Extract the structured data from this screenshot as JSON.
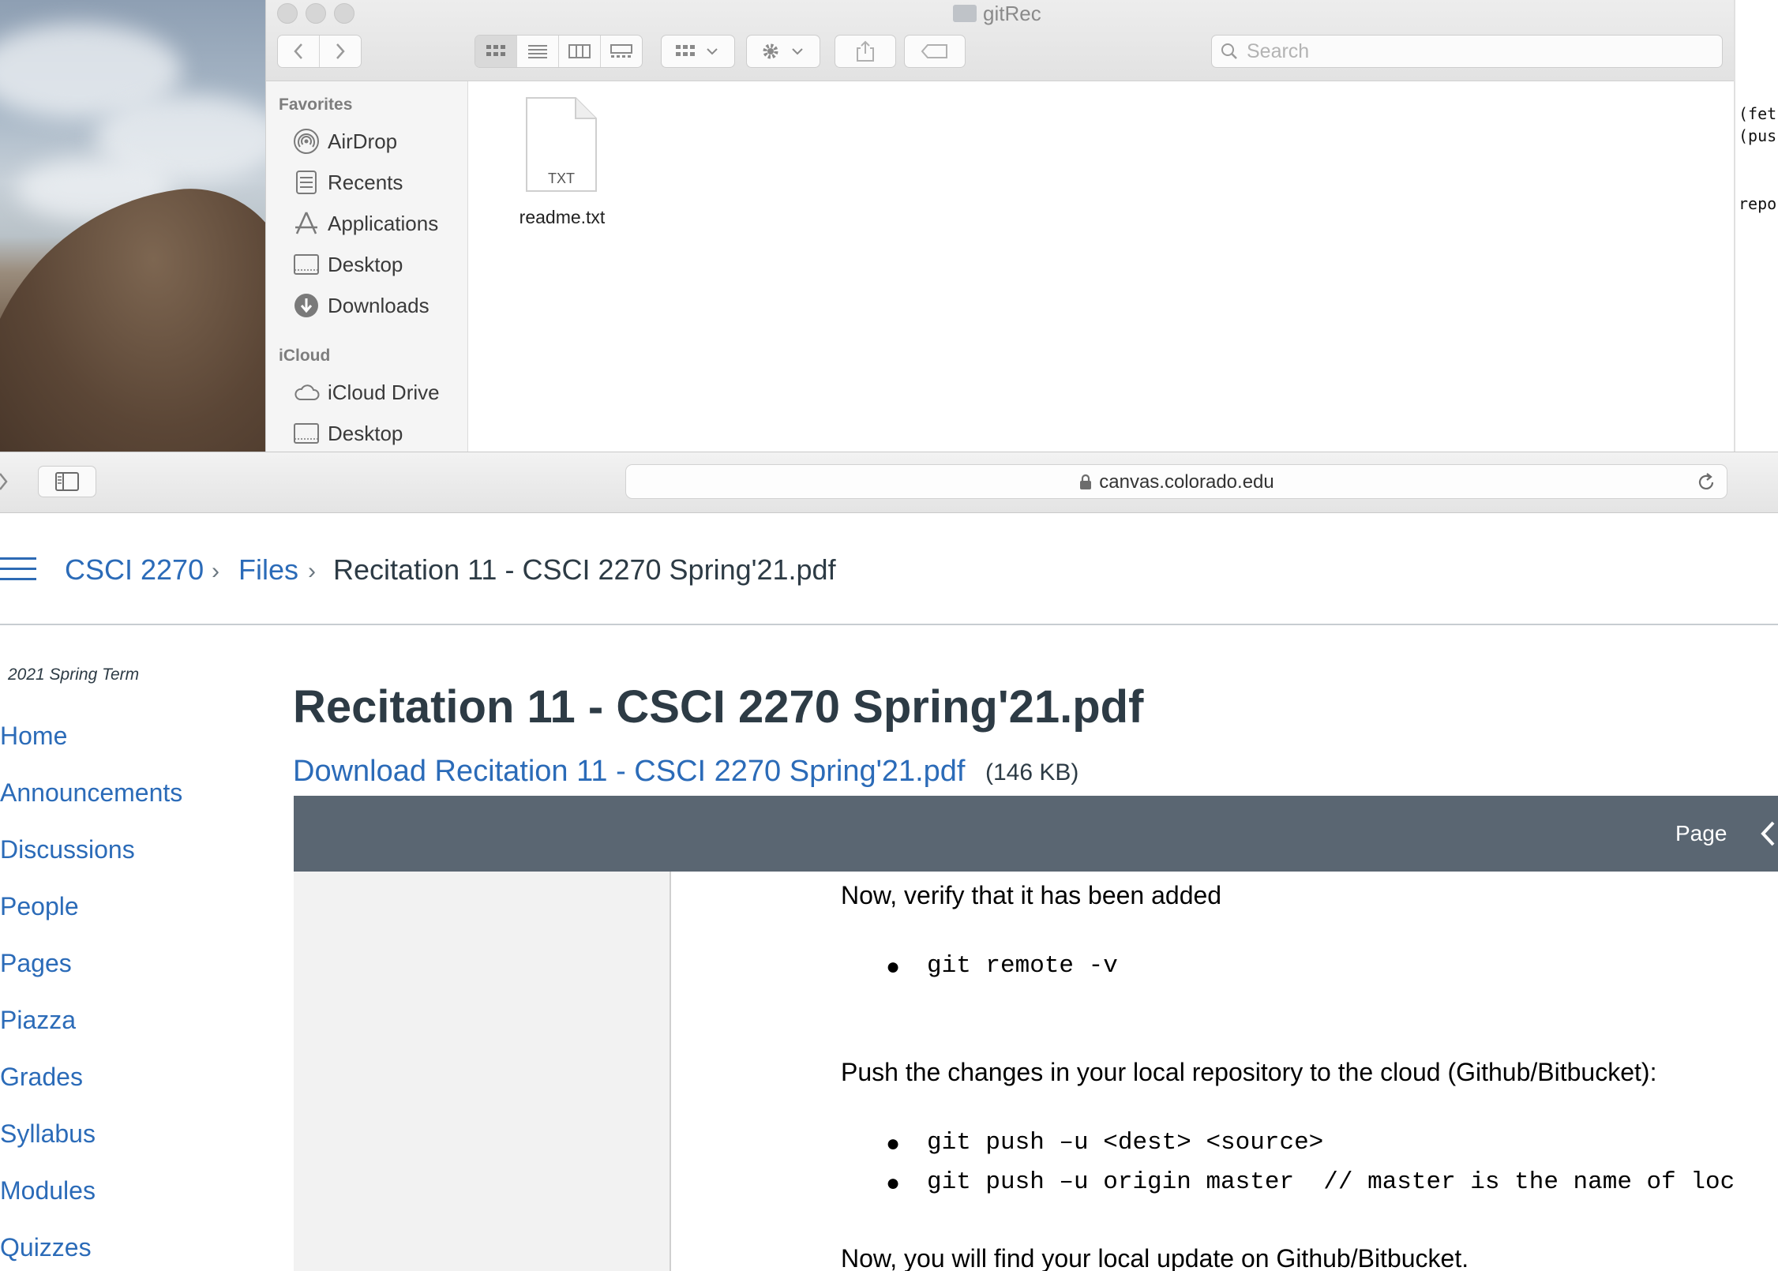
{
  "finder": {
    "title": "gitRec",
    "search_placeholder": "Search",
    "sidebar": {
      "favorites_heading": "Favorites",
      "favorites": [
        "AirDrop",
        "Recents",
        "Applications",
        "Desktop",
        "Downloads"
      ],
      "icloud_heading": "iCloud",
      "icloud": [
        "iCloud Drive",
        "Desktop"
      ]
    },
    "file": {
      "type_label": "TXT",
      "name": "readme.txt"
    }
  },
  "terminal_fragment": {
    "lines": [
      "(fet",
      "(pus",
      "repo"
    ]
  },
  "safari": {
    "address": "canvas.colorado.edu"
  },
  "canvas": {
    "breadcrumb": {
      "course": "CSCI 2270",
      "section": "Files",
      "current": "Recitation 11 - CSCI 2270 Spring'21.pdf",
      "separator": "›"
    },
    "term": "2021 Spring Term",
    "nav": [
      "Home",
      "Announcements",
      "Discussions",
      "People",
      "Pages",
      "Piazza",
      "Grades",
      "Syllabus",
      "Modules",
      "Quizzes"
    ],
    "content_title": "Recitation 11 - CSCI 2270 Spring'21.pdf",
    "download_link": "Download Recitation 11 - CSCI 2270 Spring'21.pdf",
    "file_size": "(146 KB)",
    "viewer": {
      "page_label": "Page",
      "doc": {
        "verify_text": "Now, verify that it has been added",
        "cmd_remote": "git remote -v",
        "push_text": "Push the changes in your local repository to the cloud (Github/Bitbucket):",
        "cmd_push1": "git push –u <dest> <source>",
        "cmd_push2": "git push –u origin master  // master is the name of loc",
        "final_text": "Now, you will find your local update on Github/Bitbucket.",
        "bullet": "●"
      }
    }
  }
}
